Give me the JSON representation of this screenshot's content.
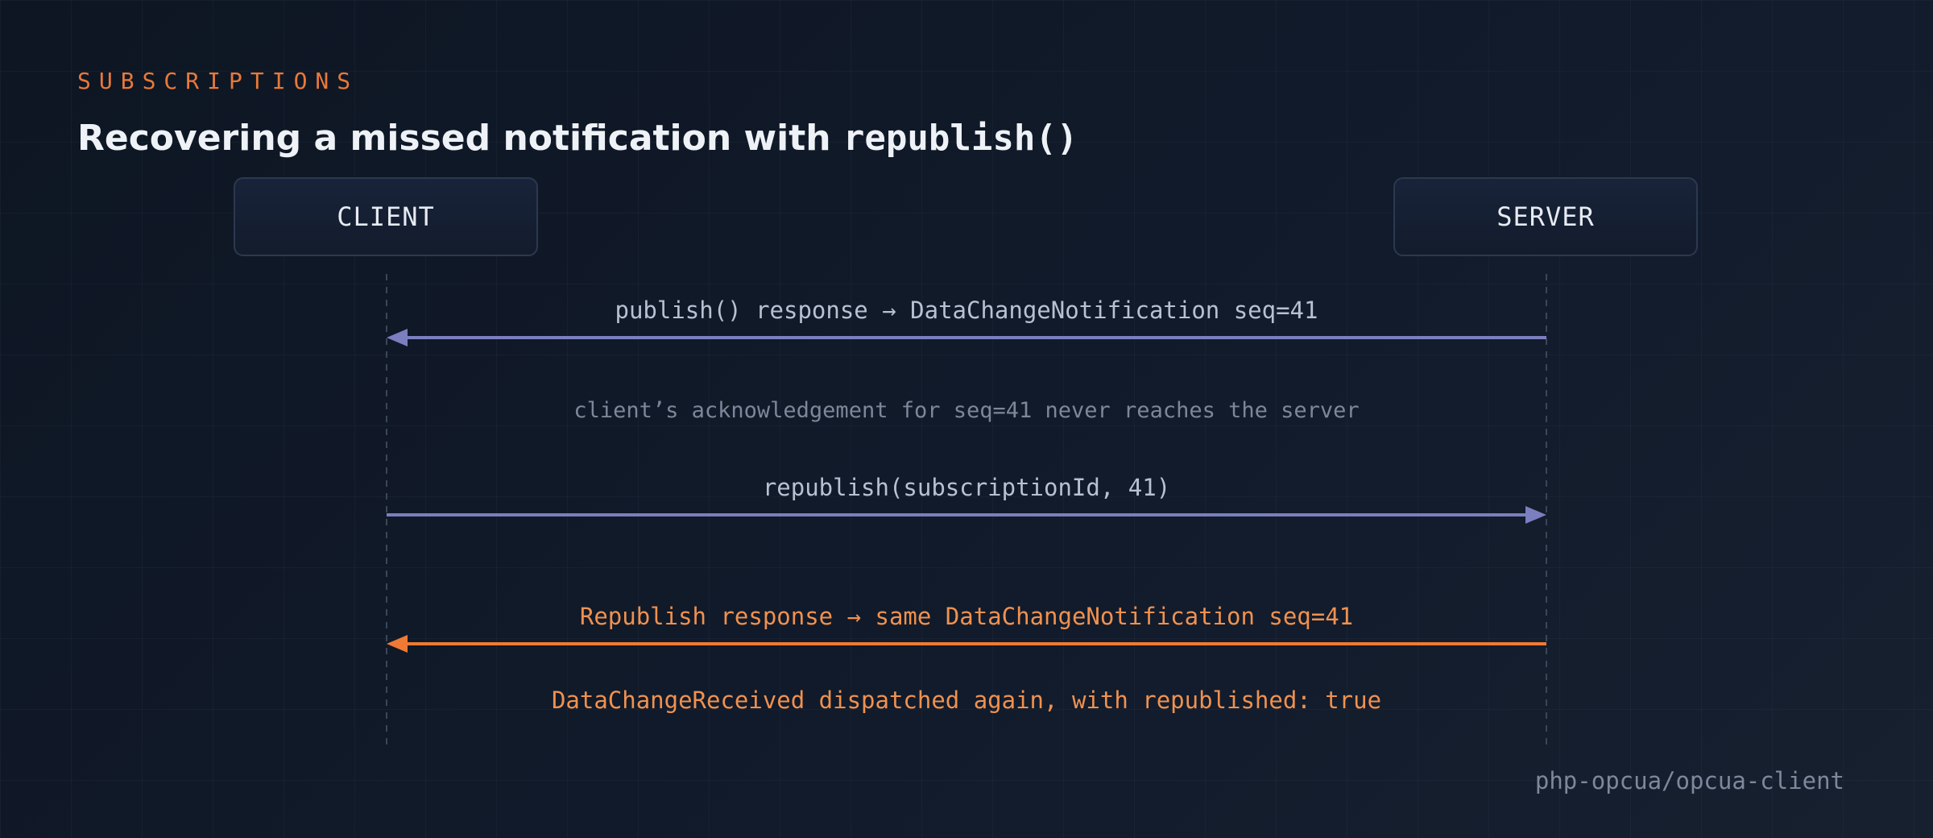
{
  "header": {
    "eyebrow": "SUBSCRIPTIONS",
    "title_prefix": "Recovering a missed notification with ",
    "title_code": "republish()"
  },
  "actors": {
    "client": "CLIENT",
    "server": "SERVER"
  },
  "messages": [
    {
      "text": "publish() response → DataChangeNotification seq=41",
      "from": "server",
      "to": "client",
      "style": "primary"
    },
    {
      "text": "client’s acknowledgement for seq=41 never reaches the server",
      "style": "note"
    },
    {
      "text": "republish(subscriptionId, 41)",
      "from": "client",
      "to": "server",
      "style": "primary"
    },
    {
      "text": "Republish response → same DataChangeNotification seq=41",
      "from": "server",
      "to": "client",
      "style": "accent"
    },
    {
      "text": "DataChangeReceived dispatched again, with republished: true",
      "style": "accent-note"
    }
  ],
  "footer": {
    "repo": "php-opcua/opcua-client"
  },
  "colors": {
    "accent": "#e8793a",
    "arrow_primary": "#7b7fbf",
    "arrow_accent": "#ef7a35",
    "lifeline": "#3a4658"
  }
}
